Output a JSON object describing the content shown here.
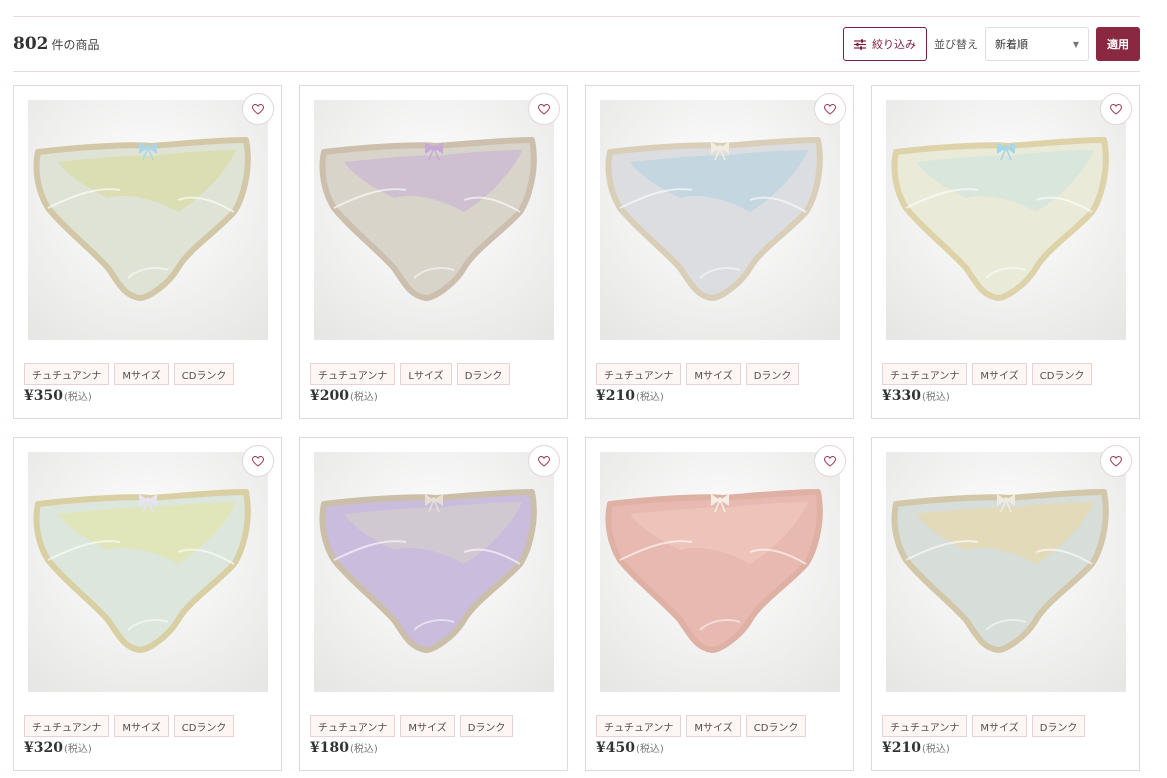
{
  "results": {
    "count": "802",
    "unit": "件の商品"
  },
  "toolbar": {
    "filter_label": "絞り込み",
    "filter_icon": "sliders-icon",
    "sort_label": "並び替え",
    "sort_selected": "新着順",
    "apply_label": "適用"
  },
  "colors": {
    "accent": "#8a2842",
    "border": "#e6d8da",
    "tag_bg": "#fdf6f5"
  },
  "products": [
    {
      "tags": [
        "チュチュアンナ",
        "Mサイズ",
        "CDランク"
      ],
      "price": "¥350",
      "tax": "(税込)",
      "colors": {
        "bg": "#e6e7e5",
        "body": "#dfe3d6",
        "trim": "#d2c8a8",
        "lace": "#d9dca0",
        "bow": "#aed6e8"
      }
    },
    {
      "tags": [
        "チュチュアンナ",
        "Lサイズ",
        "Dランク"
      ],
      "price": "¥200",
      "tax": "(税込)",
      "colors": {
        "bg": "#e8e8e6",
        "body": "#d9d4ca",
        "trim": "#cdbfae",
        "lace": "#c7b3d4",
        "bow": "#c7a9d8"
      }
    },
    {
      "tags": [
        "チュチュアンナ",
        "Mサイズ",
        "Dランク"
      ],
      "price": "¥210",
      "tax": "(税込)",
      "colors": {
        "bg": "#e7e8e9",
        "body": "#dcdde0",
        "trim": "#d9cfb9",
        "lace": "#b7d3df",
        "bow": "#f2ecdf"
      }
    },
    {
      "tags": [
        "チュチュアンナ",
        "Mサイズ",
        "CDランク"
      ],
      "price": "¥330",
      "tax": "(税込)",
      "colors": {
        "bg": "#e8e9e6",
        "body": "#e9ead7",
        "trim": "#ddd2a8",
        "lace": "#cfe3de",
        "bow": "#a6d6e9"
      }
    },
    {
      "tags": [
        "チュチュアンナ",
        "Mサイズ",
        "CDランク"
      ],
      "price": "¥320",
      "tax": "(税込)",
      "colors": {
        "bg": "#e7e8e6",
        "body": "#dde6dc",
        "trim": "#d8cfa3",
        "lace": "#e2e5a8",
        "bow": "#e8e2f1"
      }
    },
    {
      "tags": [
        "チュチュアンナ",
        "Mサイズ",
        "Dランク"
      ],
      "price": "¥180",
      "tax": "(税込)",
      "colors": {
        "bg": "#e9e8ea",
        "body": "#c9bcdd",
        "trim": "#cbbfa9",
        "lace": "#d5cfcc",
        "bow": "#e7dfd3"
      }
    },
    {
      "tags": [
        "チュチュアンナ",
        "Mサイズ",
        "CDランク"
      ],
      "price": "¥450",
      "tax": "(税込)",
      "colors": {
        "bg": "#ebe9e8",
        "body": "#e7b9b0",
        "trim": "#dfb0a4",
        "lace": "#efc8c0",
        "bow": "#f3efe6"
      }
    },
    {
      "tags": [
        "チュチュアンナ",
        "Mサイズ",
        "Dランク"
      ],
      "price": "¥210",
      "tax": "(税込)",
      "colors": {
        "bg": "#e7e8e7",
        "body": "#d7ddd9",
        "trim": "#d2c7a9",
        "lace": "#ead8a8",
        "bow": "#f0ebe0"
      }
    }
  ]
}
